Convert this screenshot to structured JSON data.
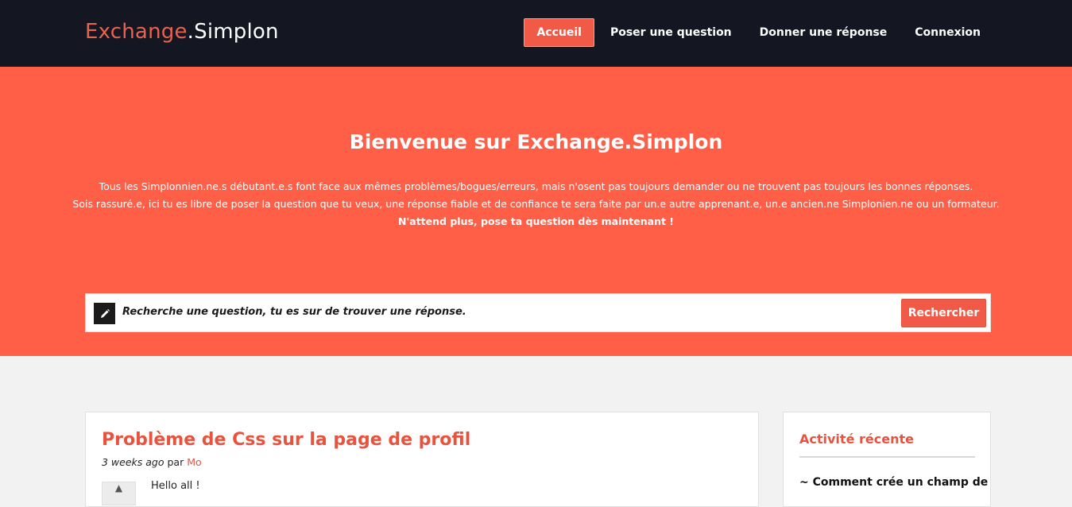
{
  "brand": {
    "part1": "Exchange",
    "part2": ".Simplon"
  },
  "nav": {
    "items": [
      {
        "label": "Accueil",
        "active": true
      },
      {
        "label": "Poser une question",
        "active": false
      },
      {
        "label": "Donner une réponse",
        "active": false
      },
      {
        "label": "Connexion",
        "active": false
      }
    ]
  },
  "hero": {
    "title": "Bienvenue sur Exchange.Simplon",
    "line1": "Tous les Simplonnien.ne.s débutant.e.s font face aux mêmes problèmes/bogues/erreurs, mais n'osent pas toujours demander ou ne trouvent pas toujours les bonnes réponses.",
    "line2": "Sois rassuré.e, ici tu es libre de poser la question que tu veux, une réponse fiable et de confiance te sera faite par un.e autre apprenant.e, un.e ancien.ne Simplonien.ne ou un formateur.",
    "line3": "N'attend plus, pose ta question dès maintenant !"
  },
  "search": {
    "text": "Recherche une question, tu es sur de trouver une réponse.",
    "button": "Rechercher"
  },
  "question": {
    "title": "Problème de Css sur la page de profil",
    "time": "3 weeks ago",
    "by": "par",
    "author": "Mo",
    "excerpt": "Hello all !"
  },
  "sidebar": {
    "title": "Activité récente",
    "item": "~ Comment crée un champ de"
  },
  "colors": {
    "accent": "#ff5e47",
    "navbar": "#141721",
    "link": "#e9523d"
  }
}
